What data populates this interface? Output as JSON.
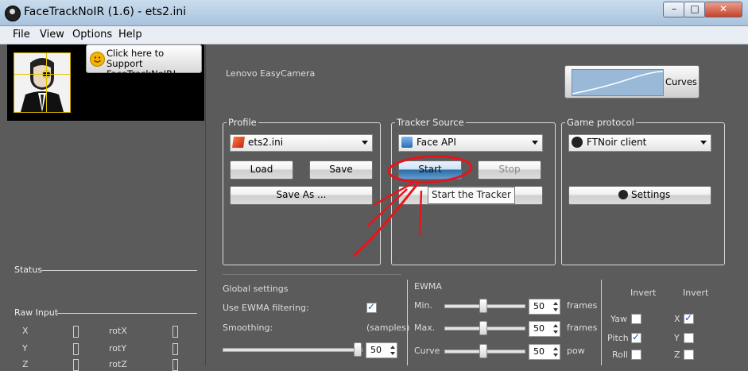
{
  "window": {
    "title": "FaceTrackNoIR (1.6) - ets2.ini",
    "min": "–",
    "max": "□",
    "close": "✕"
  },
  "menu": [
    "File",
    "View",
    "Options",
    "Help"
  ],
  "support": {
    "line1": "Click here to",
    "line2": "Support FaceTrackNoIR!"
  },
  "left": {
    "status_label": "Status",
    "raw_input_label": "Raw Input",
    "raw": [
      {
        "a": "X",
        "b": "rotX"
      },
      {
        "a": "Y",
        "b": "rotY"
      },
      {
        "a": "Z",
        "b": "rotZ"
      }
    ]
  },
  "camera": "Lenovo EasyCamera",
  "curves": {
    "label": "Curves"
  },
  "profile": {
    "title": "Profile",
    "value": "ets2.ini",
    "load": "Load",
    "save": "Save",
    "save_as": "Save As ..."
  },
  "tracker": {
    "title": "Tracker Source",
    "value": "Face API",
    "start": "Start",
    "stop": "Stop",
    "tooltip": "Start the Tracker"
  },
  "protocol": {
    "title": "Game protocol",
    "value": "FTNoir client",
    "settings": "Settings"
  },
  "global": {
    "title": "Global settings",
    "ewma_filter": "Use EWMA filtering:",
    "ewma_checked": true,
    "smoothing": "Smoothing:",
    "samples": "(samples)",
    "smoothing_value": "50"
  },
  "ewma": {
    "title": "EWMA",
    "rows": [
      {
        "label": "Min.",
        "value": "50",
        "unit": "frames"
      },
      {
        "label": "Max.",
        "value": "50",
        "unit": "frames"
      },
      {
        "label": "Curve",
        "value": "50",
        "unit": "pow"
      }
    ]
  },
  "invert": {
    "header": "Invert",
    "left": [
      {
        "label": "Yaw",
        "checked": false
      },
      {
        "label": "Pitch",
        "checked": true
      },
      {
        "label": "Roll",
        "checked": false
      }
    ],
    "right": [
      {
        "label": "X",
        "checked": true
      },
      {
        "label": "Y",
        "checked": false
      },
      {
        "label": "Z",
        "checked": false
      }
    ]
  },
  "colors": {
    "background": "#5b5b5b",
    "annotation": "#e8141b",
    "accent": "#2e6da4"
  }
}
